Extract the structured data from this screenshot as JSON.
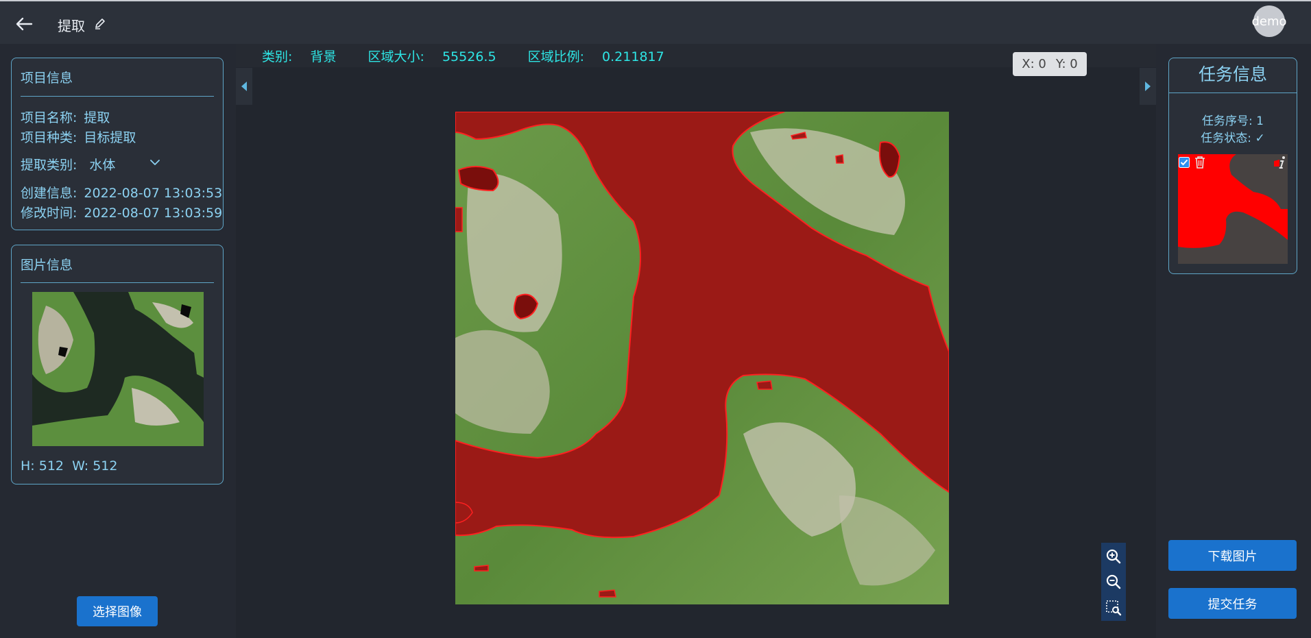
{
  "header": {
    "title": "提取",
    "avatar_text": "demo"
  },
  "project": {
    "title": "项目信息",
    "name_label": "项目名称:",
    "name_value": "提取",
    "type_label": "项目种类:",
    "type_value": "目标提取",
    "category_label": "提取类别:",
    "category_value": "水体",
    "created_label": "创建信息:",
    "created_value": "2022-08-07 13:03:53",
    "modified_label": "修改时间:",
    "modified_value": "2022-08-07 13:03:59"
  },
  "image_info": {
    "title": "图片信息",
    "h_label": "H:",
    "h_value": "512",
    "w_label": "W:",
    "w_value": "512"
  },
  "buttons": {
    "choose_image": "选择图像",
    "download_image": "下载图片",
    "submit_task": "提交任务"
  },
  "stage": {
    "class_label": "类别:",
    "class_value": "背景",
    "area_label": "区域大小:",
    "area_value": "55526.5",
    "ratio_label": "区域比例:",
    "ratio_value": "0.211817",
    "x_label": "X:",
    "x_value": "0",
    "y_label": "Y:",
    "y_value": "0"
  },
  "task": {
    "title": "任务信息",
    "index_label": "任务序号:",
    "index_value": "1",
    "status_label": "任务状态:",
    "status_value": "✓"
  },
  "colors": {
    "accent": "#1a72cd",
    "panel_border": "#5fa6c8",
    "label_text": "#8cd2f2",
    "info_text": "#2ee6e6",
    "mask_red": "#9b1a16"
  }
}
